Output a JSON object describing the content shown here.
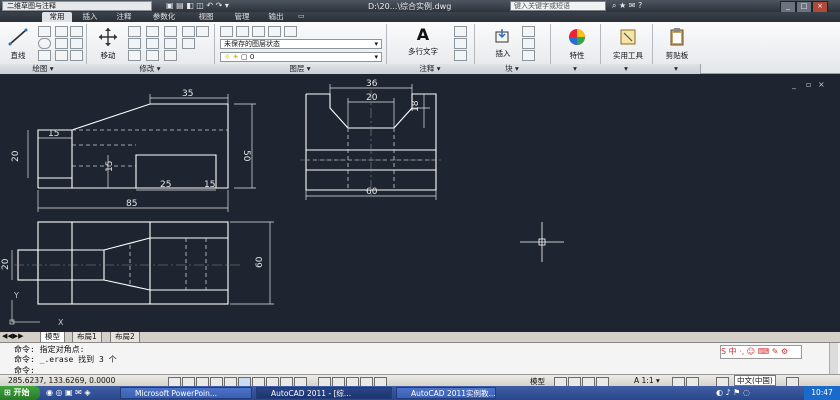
{
  "window": {
    "workspace": "二维草图与注释",
    "title": "D:\\20...\\综合实例.dwg",
    "search_placeholder": "键入关键字或短语"
  },
  "ribbon_tabs": [
    "常用",
    "插入",
    "注释",
    "参数化",
    "视图",
    "管理",
    "输出"
  ],
  "panels": {
    "draw": "绘图",
    "modify": "修改",
    "layers": "图层",
    "annotation": "注释",
    "block": "块",
    "line_label": "直线",
    "move_label": "移动",
    "mtext_label": "多行文字",
    "insert_label": "插入",
    "properties_label": "特性",
    "utilities_label": "实用工具",
    "clipboard_label": "剪贴板",
    "layer_state": "未保存的图层状态",
    "layer_name": "0"
  },
  "drawing": {
    "dims": {
      "d15a": "15",
      "d20a": "20",
      "d35": "35",
      "d50": "50",
      "d15b": "15",
      "d25": "25",
      "d15c": "15",
      "d85": "85",
      "d36": "36",
      "d20b": "20",
      "d18": "18",
      "d60a": "60",
      "d20c": "20",
      "d60b": "60"
    },
    "ucs_y": "Y",
    "ucs_x": "X"
  },
  "layout_tabs": [
    "模型",
    "布局1",
    "布局2"
  ],
  "command": {
    "line1": "命令: 指定对角点:",
    "line2": "命令: _.erase 找到 3 个",
    "line3": "命令:"
  },
  "status": {
    "coords": "285.6237, 133.6269, 0.0000",
    "model": "模型",
    "scale": "1:1"
  },
  "taskbar": {
    "start": "开始",
    "tasks": [
      "Microsoft PowerPoin...",
      "AutoCAD 2011 - [综...",
      "AutoCAD 2011实例教..."
    ],
    "ime": "中文(中国)",
    "clock": "10:47"
  },
  "colors": {
    "canvas": "#1e2430",
    "lines": "#ffffff",
    "dims": "#e6e6e6",
    "ribbon": "#eef0f2"
  }
}
